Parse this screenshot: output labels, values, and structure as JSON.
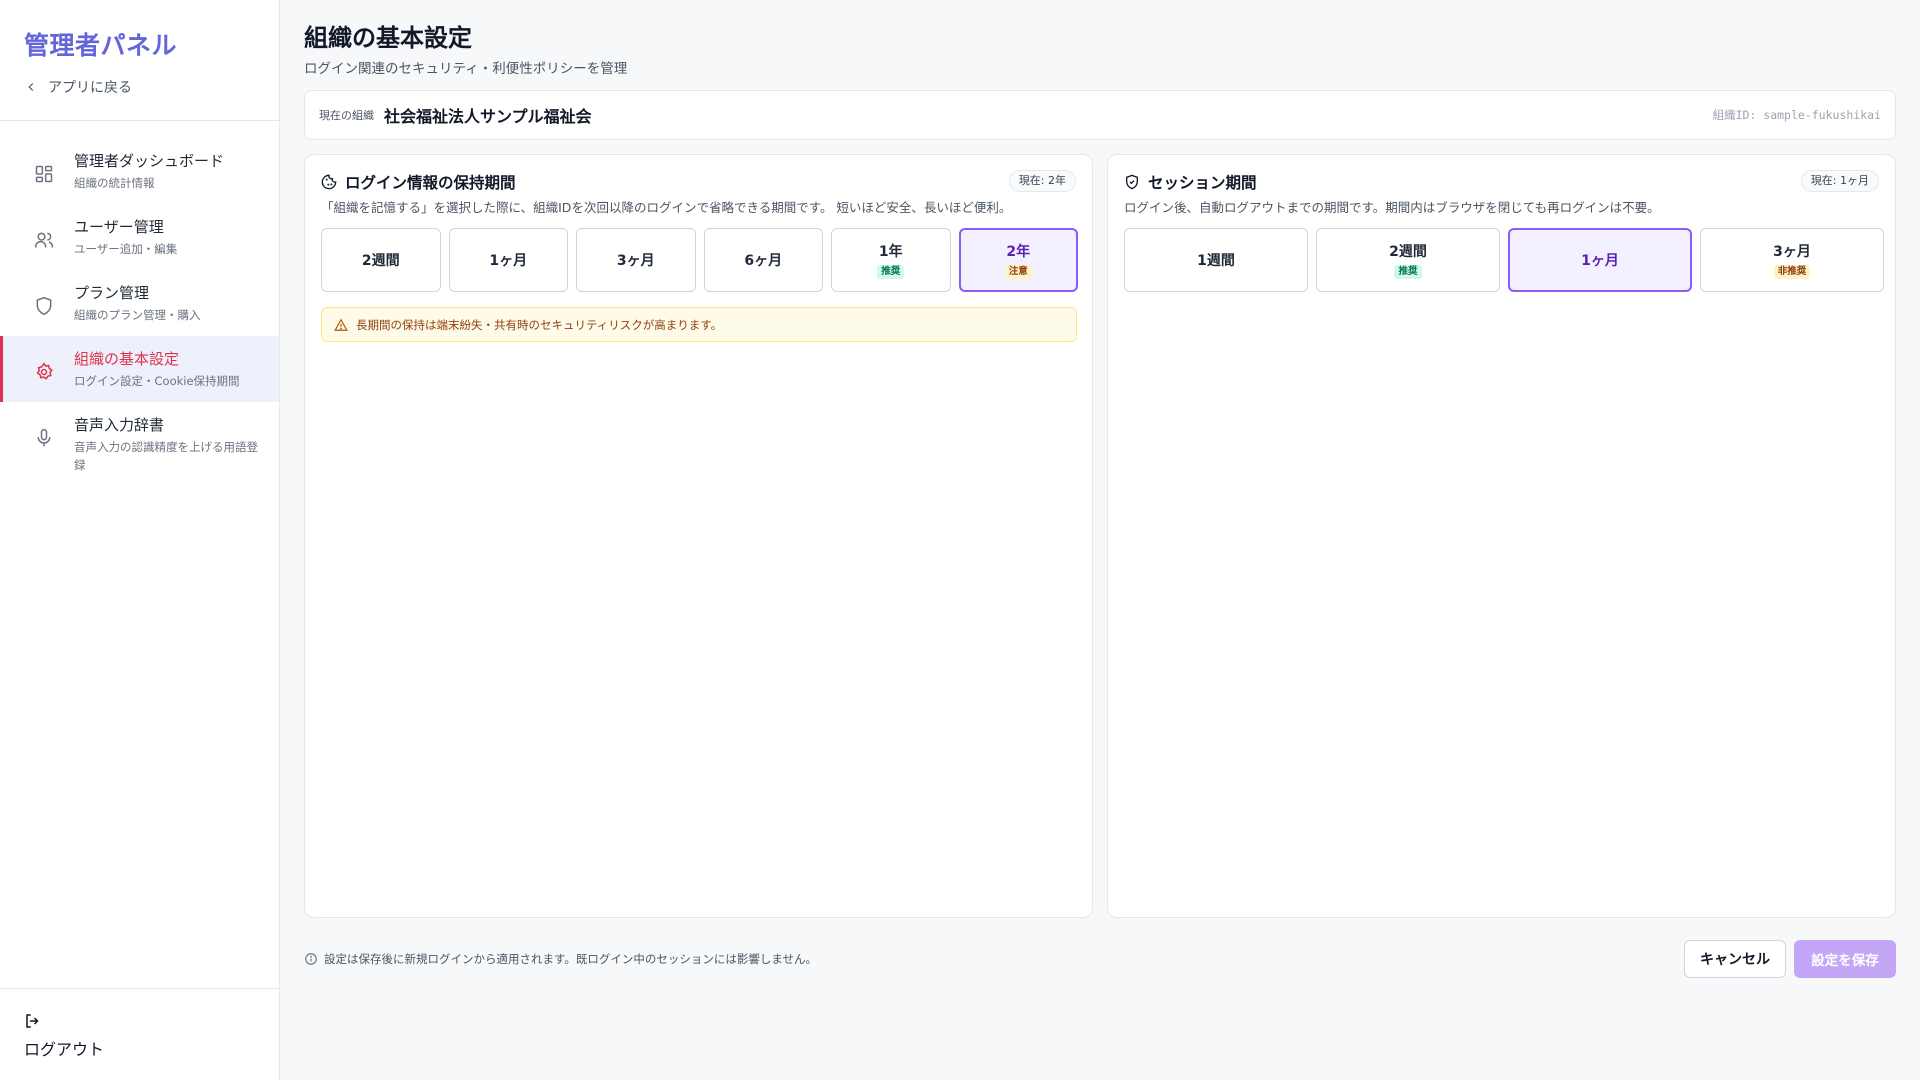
{
  "sidebar": {
    "brand": "管理者パネル",
    "back_label": "アプリに戻る",
    "items": [
      {
        "label": "管理者ダッシュボード",
        "sub": "組織の統計情報",
        "icon": "dashboard-icon"
      },
      {
        "label": "ユーザー管理",
        "sub": "ユーザー追加・編集",
        "icon": "users-icon"
      },
      {
        "label": "プラン管理",
        "sub": "組織のプラン管理・購入",
        "icon": "shield-icon"
      },
      {
        "label": "組織の基本設定",
        "sub": "ログイン設定・Cookie保持期間",
        "icon": "gear-icon",
        "active": true
      },
      {
        "label": "音声入力辞書",
        "sub": "音声入力の認識精度を上げる用語登録",
        "icon": "microphone-icon"
      }
    ],
    "logout_label": "ログアウト"
  },
  "header": {
    "title": "組織の基本設定",
    "subtitle": "ログイン関連のセキュリティ・利便性ポリシーを管理"
  },
  "org": {
    "label": "現在の組織",
    "name": "社会福祉法人サンプル福祉会",
    "id_text": "組織ID: sample-fukushikai"
  },
  "retention": {
    "title": "ログイン情報の保持期間",
    "current": "現在: 2年",
    "description": "「組織を記憶する」を選択した際に、組織IDを次回以降のログインで省略できる期間です。 短いほど安全、長いほど便利。",
    "options": [
      {
        "label": "2週間",
        "badge": ""
      },
      {
        "label": "1ヶ月",
        "badge": ""
      },
      {
        "label": "3ヶ月",
        "badge": ""
      },
      {
        "label": "6ヶ月",
        "badge": ""
      },
      {
        "label": "1年",
        "badge": "推奨"
      },
      {
        "label": "2年",
        "badge": "注意",
        "selected": true
      }
    ],
    "warning": "長期間の保持は端末紛失・共有時のセキュリティリスクが高まります。"
  },
  "session": {
    "title": "セッション期間",
    "current": "現在: 1ヶ月",
    "description": "ログイン後、自動ログアウトまでの期間です。期間内はブラウザを閉じても再ログインは不要。",
    "options": [
      {
        "label": "1週間",
        "badge": ""
      },
      {
        "label": "2週間",
        "badge": "推奨"
      },
      {
        "label": "1ヶ月",
        "badge": "",
        "selected": true
      },
      {
        "label": "3ヶ月",
        "badge": "非推奨"
      }
    ]
  },
  "footer": {
    "note": "設定は保存後に新規ログインから適用されます。既ログイン中のセッションには影響しません。",
    "cancel_label": "キャンセル",
    "save_label": "設定を保存"
  },
  "colors": {
    "brand": "#6366d9",
    "active_nav": "#e0334b",
    "selected_border": "#8b5cf6",
    "save_button": "#c4a6f6"
  }
}
